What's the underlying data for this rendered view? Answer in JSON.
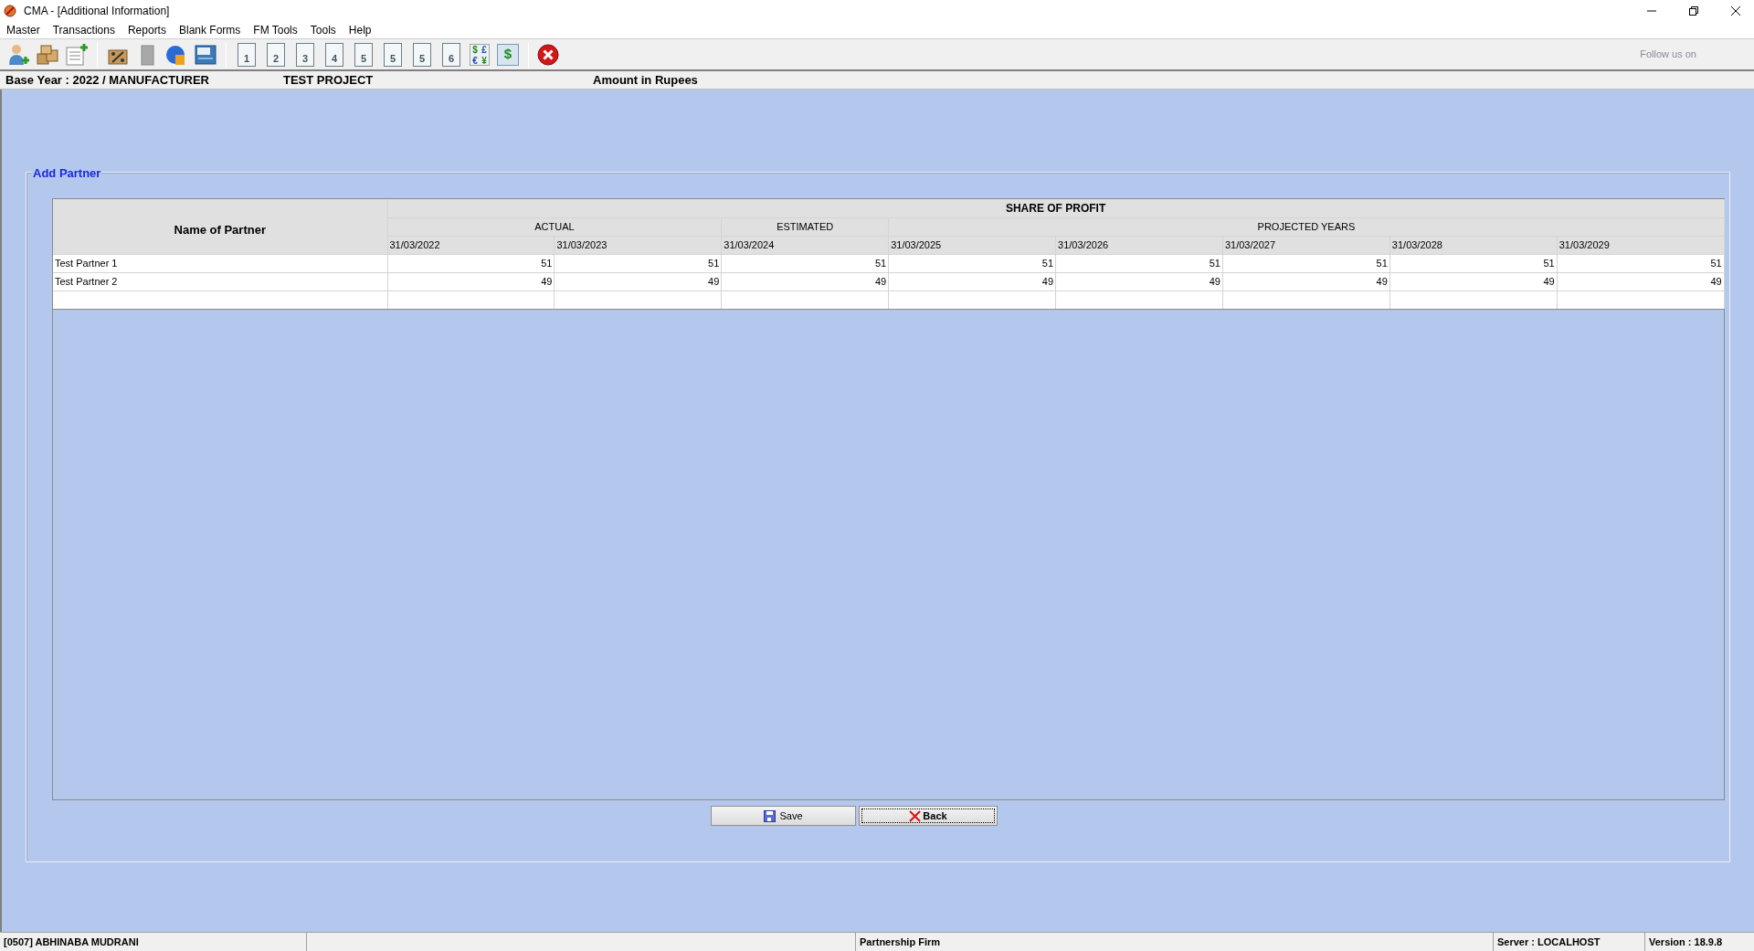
{
  "window": {
    "title": "CMA - [Additional Information]"
  },
  "menu": [
    "Master",
    "Transactions",
    "Reports",
    "Blank Forms",
    "FM Tools",
    "Tools",
    "Help"
  ],
  "toolbar": {
    "page_buttons": [
      "1",
      "2",
      "3",
      "4",
      "5",
      "5",
      "5",
      "6"
    ],
    "currency_symbols": [
      "$",
      "£",
      "€",
      "¥"
    ],
    "dollar_symbol": "$",
    "follow_text": "Follow us on"
  },
  "info_bar": {
    "base_year": "Base Year : 2022 / MANUFACTURER",
    "project": "TEST PROJECT",
    "amount": "Amount in Rupees"
  },
  "group": {
    "title": "Add Partner"
  },
  "table": {
    "name_header": "Name of Partner",
    "share_header": "SHARE OF PROFIT",
    "groups": [
      {
        "label": "ACTUAL",
        "columns": [
          "31/03/2022",
          "31/03/2023"
        ]
      },
      {
        "label": "ESTIMATED",
        "columns": [
          "31/03/2024"
        ]
      },
      {
        "label": "PROJECTED YEARS",
        "columns": [
          "31/03/2025",
          "31/03/2026",
          "31/03/2027",
          "31/03/2028",
          "31/03/2029"
        ]
      }
    ],
    "rows": [
      {
        "name": "Test Partner 1",
        "values": [
          "51",
          "51",
          "51",
          "51",
          "51",
          "51",
          "51",
          "51"
        ]
      },
      {
        "name": "Test Partner 2",
        "values": [
          "49",
          "49",
          "49",
          "49",
          "49",
          "49",
          "49",
          "49"
        ]
      }
    ]
  },
  "buttons": {
    "save": "Save",
    "back": "Back"
  },
  "status_bar": {
    "user": "[0507] ABHINABA MUDRANI",
    "firm_type": "Partnership Firm",
    "server": "Server : LOCALHOST",
    "version": "Version : 18.9.8"
  }
}
